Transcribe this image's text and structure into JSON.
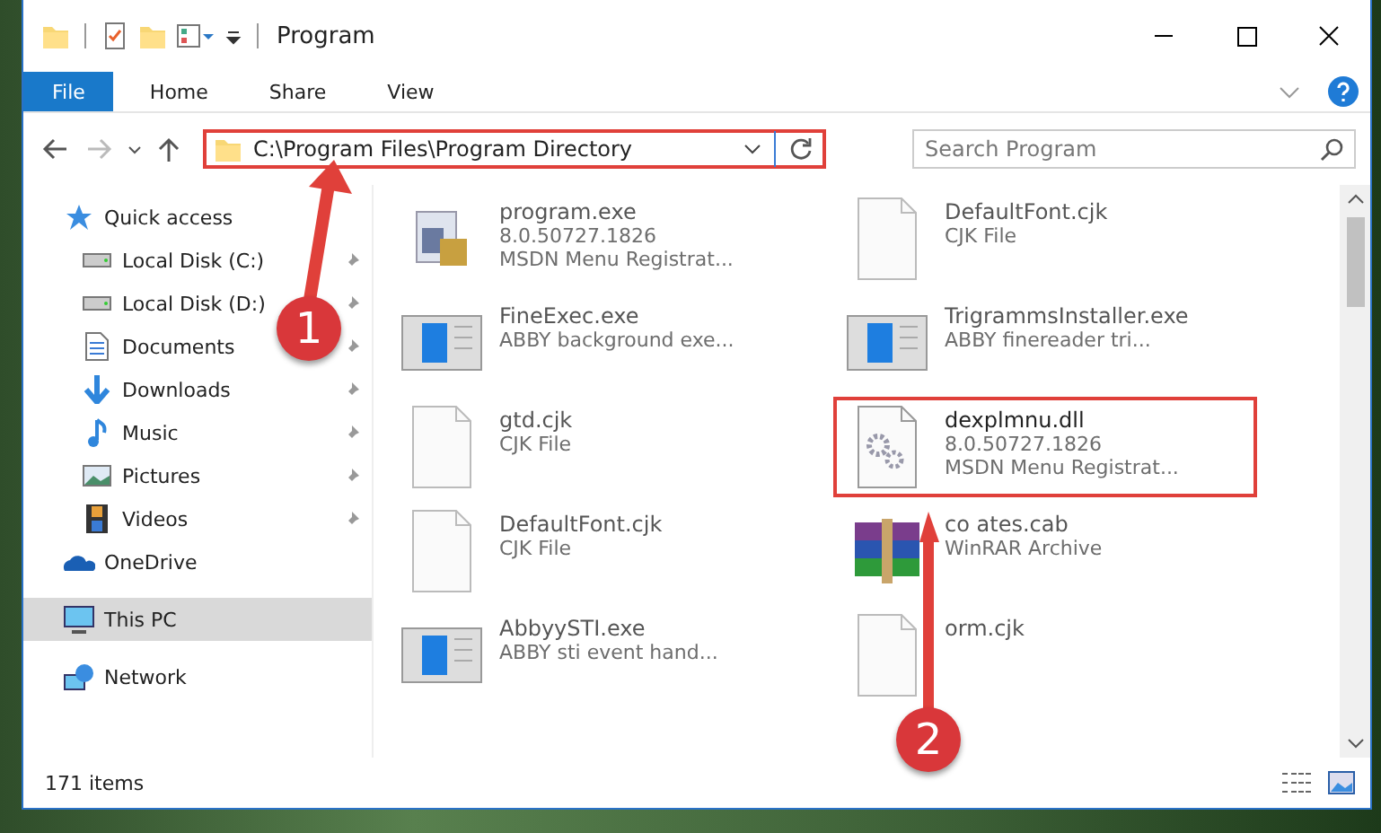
{
  "window": {
    "title": "Program"
  },
  "ribbon_tabs": [
    {
      "label": "File",
      "selected": true
    },
    {
      "label": "Home",
      "selected": false
    },
    {
      "label": "Share",
      "selected": false
    },
    {
      "label": "View",
      "selected": false
    }
  ],
  "address": {
    "path": "C:\\Program Files\\Program Directory",
    "highlighted": true
  },
  "search": {
    "placeholder": "Search Program"
  },
  "sidebar": {
    "items": [
      {
        "label": "Quick access",
        "selected": false,
        "children": [
          {
            "label": "Local Disk (C:)",
            "pinned": true,
            "selected": false
          },
          {
            "label": "Local Disk (D:)",
            "pinned": true,
            "selected": false
          },
          {
            "label": "Documents",
            "pinned": true,
            "selected": false
          },
          {
            "label": "Downloads",
            "pinned": true,
            "selected": false
          },
          {
            "label": "Music",
            "pinned": true,
            "selected": false
          },
          {
            "label": "Pictures",
            "pinned": true,
            "selected": false
          },
          {
            "label": "Videos",
            "pinned": true,
            "selected": false
          }
        ]
      },
      {
        "label": "OneDrive",
        "selected": false
      },
      {
        "label": "This PC",
        "selected": true
      },
      {
        "label": "Network",
        "selected": false
      }
    ]
  },
  "files": [
    {
      "kind": "setup",
      "name": "program.exe",
      "lines": [
        "8.0.50727.1826",
        "MSDN Menu Registrat..."
      ],
      "highlighted": false
    },
    {
      "kind": "blank",
      "name": "DefaultFont.cjk",
      "lines": [
        "CJK File"
      ],
      "highlighted": false
    },
    {
      "kind": "window",
      "name": "FineExec.exe",
      "lines": [
        "ABBY background exe..."
      ],
      "highlighted": false
    },
    {
      "kind": "window",
      "name": "TrigrammsInstaller.exe",
      "lines": [
        "ABBY finereader tri..."
      ],
      "highlighted": false
    },
    {
      "kind": "blank",
      "name": "gtd.cjk",
      "lines": [
        "CJK File"
      ],
      "highlighted": false
    },
    {
      "kind": "gear",
      "name": "dexplmnu.dll",
      "lines": [
        "8.0.50727.1826",
        "MSDN Menu Registrat..."
      ],
      "highlighted": true
    },
    {
      "kind": "blank",
      "name": "DefaultFont.cjk",
      "lines": [
        "CJK File"
      ],
      "highlighted": false
    },
    {
      "kind": "archive",
      "name": "co ates.cab",
      "lines": [
        "WinRAR Archive"
      ],
      "highlighted": false
    },
    {
      "kind": "window",
      "name": "AbbyySTI.exe",
      "lines": [
        "ABBY sti event hand..."
      ],
      "highlighted": false
    },
    {
      "kind": "blank",
      "name": "orm.cjk",
      "highlighted": false
    }
  ],
  "annotations": [
    {
      "label": "1"
    },
    {
      "label": "2"
    }
  ],
  "status_bar": {
    "count": "171 items"
  }
}
